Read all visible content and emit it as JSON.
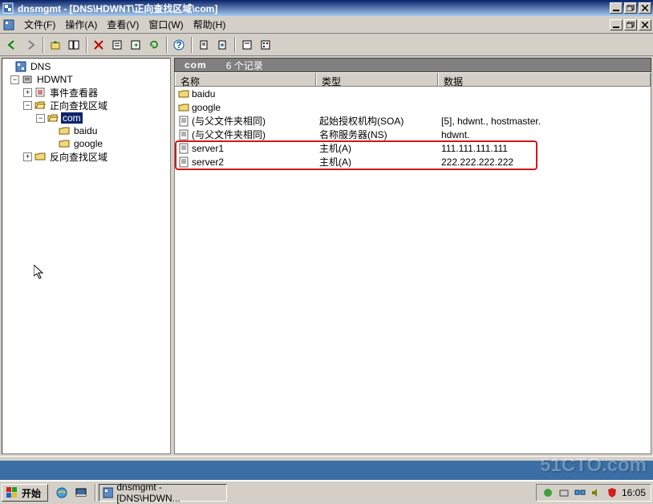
{
  "title": "dnsmgmt - [DNS\\HDWNT\\正向查找区域\\com]",
  "menu": {
    "file": "文件(F)",
    "action": "操作(A)",
    "view": "查看(V)",
    "window": "窗口(W)",
    "help": "帮助(H)"
  },
  "pathbar": {
    "path": "com",
    "count": "6 个记录"
  },
  "columns": {
    "name": "名称",
    "type": "类型",
    "data": "数据"
  },
  "tree": {
    "root": "DNS",
    "server": "HDWNT",
    "eventviewer": "事件查看器",
    "fwd_zone": "正向查找区域",
    "com": "com",
    "baidu": "baidu",
    "google": "google",
    "rev_zone": "反向查找区域"
  },
  "rows": [
    {
      "icon": "folder",
      "name": "baidu",
      "type": "",
      "data": ""
    },
    {
      "icon": "folder",
      "name": "google",
      "type": "",
      "data": ""
    },
    {
      "icon": "record",
      "name": "(与父文件夹相同)",
      "type": "起始授权机构(SOA)",
      "data": "[5], hdwnt., hostmaster."
    },
    {
      "icon": "record",
      "name": "(与父文件夹相同)",
      "type": "名称服务器(NS)",
      "data": "hdwnt."
    },
    {
      "icon": "record",
      "name": "server1",
      "type": "主机(A)",
      "data": "111.111.111.111"
    },
    {
      "icon": "record",
      "name": "server2",
      "type": "主机(A)",
      "data": "222.222.222.222"
    }
  ],
  "taskbar": {
    "start": "开始",
    "task1": "dnsmgmt - [DNS\\HDWN...",
    "clock": "16:05"
  },
  "watermark": "51CTO.com"
}
